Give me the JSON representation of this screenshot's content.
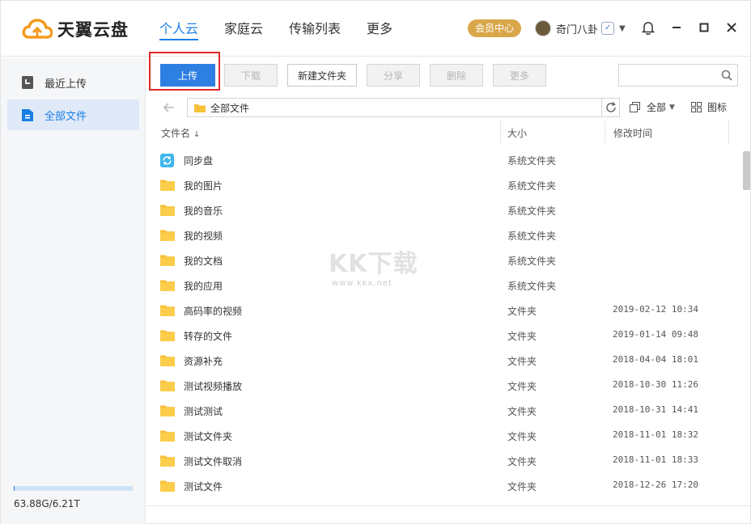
{
  "app": {
    "name": "天翼云盘"
  },
  "header": {
    "nav": [
      {
        "label": "个人云",
        "active": true
      },
      {
        "label": "家庭云",
        "active": false
      },
      {
        "label": "传输列表",
        "active": false
      },
      {
        "label": "更多",
        "active": false
      }
    ],
    "vip_label": "会员中心",
    "username": "奇门八卦"
  },
  "sidebar": {
    "items": [
      {
        "label": "最近上传",
        "icon": "recent-icon",
        "active": false
      },
      {
        "label": "全部文件",
        "icon": "files-icon",
        "active": true
      }
    ],
    "quota_text": "63.88G/6.21T",
    "quota_fraction": 0.01
  },
  "toolbar": {
    "upload": "上传",
    "download": "下载",
    "new_folder": "新建文件夹",
    "share": "分享",
    "delete": "删除",
    "more": "更多",
    "search_placeholder": ""
  },
  "pathbar": {
    "path": "全部文件",
    "filter_label": "全部",
    "view_label": "图标"
  },
  "table": {
    "columns": {
      "name": "文件名",
      "size": "大小",
      "time": "修改时间"
    },
    "rows": [
      {
        "name": "同步盘",
        "size": "系统文件夹",
        "time": "",
        "icon": "sync-folder-icon"
      },
      {
        "name": "我的图片",
        "size": "系统文件夹",
        "time": "",
        "icon": "folder-icon"
      },
      {
        "name": "我的音乐",
        "size": "系统文件夹",
        "time": "",
        "icon": "folder-icon"
      },
      {
        "name": "我的视频",
        "size": "系统文件夹",
        "time": "",
        "icon": "folder-icon"
      },
      {
        "name": "我的文档",
        "size": "系统文件夹",
        "time": "",
        "icon": "folder-icon"
      },
      {
        "name": "我的应用",
        "size": "系统文件夹",
        "time": "",
        "icon": "folder-icon"
      },
      {
        "name": "高码率的视频",
        "size": "文件夹",
        "time": "2019-02-12 10:34",
        "icon": "folder-icon"
      },
      {
        "name": "转存的文件",
        "size": "文件夹",
        "time": "2019-01-14 09:48",
        "icon": "folder-icon"
      },
      {
        "name": "资源补充",
        "size": "文件夹",
        "time": "2018-04-04 18:01",
        "icon": "folder-icon"
      },
      {
        "name": "测试视频播放",
        "size": "文件夹",
        "time": "2018-10-30 11:26",
        "icon": "folder-icon"
      },
      {
        "name": "测试测试",
        "size": "文件夹",
        "time": "2018-10-31 14:41",
        "icon": "folder-icon"
      },
      {
        "name": "测试文件夹",
        "size": "文件夹",
        "time": "2018-11-01 18:32",
        "icon": "folder-icon"
      },
      {
        "name": "测试文件取消",
        "size": "文件夹",
        "time": "2018-11-01 18:33",
        "icon": "folder-icon"
      },
      {
        "name": "测试文件",
        "size": "文件夹",
        "time": "2018-12-26 17:20",
        "icon": "folder-icon"
      }
    ]
  },
  "watermark": {
    "big": "KK下载",
    "small": "www.kkx.net"
  },
  "colors": {
    "accent": "#1a7fe5",
    "vip": "#d9a74a",
    "folder": "#f7c23b",
    "highlight": "#e02a2a"
  }
}
